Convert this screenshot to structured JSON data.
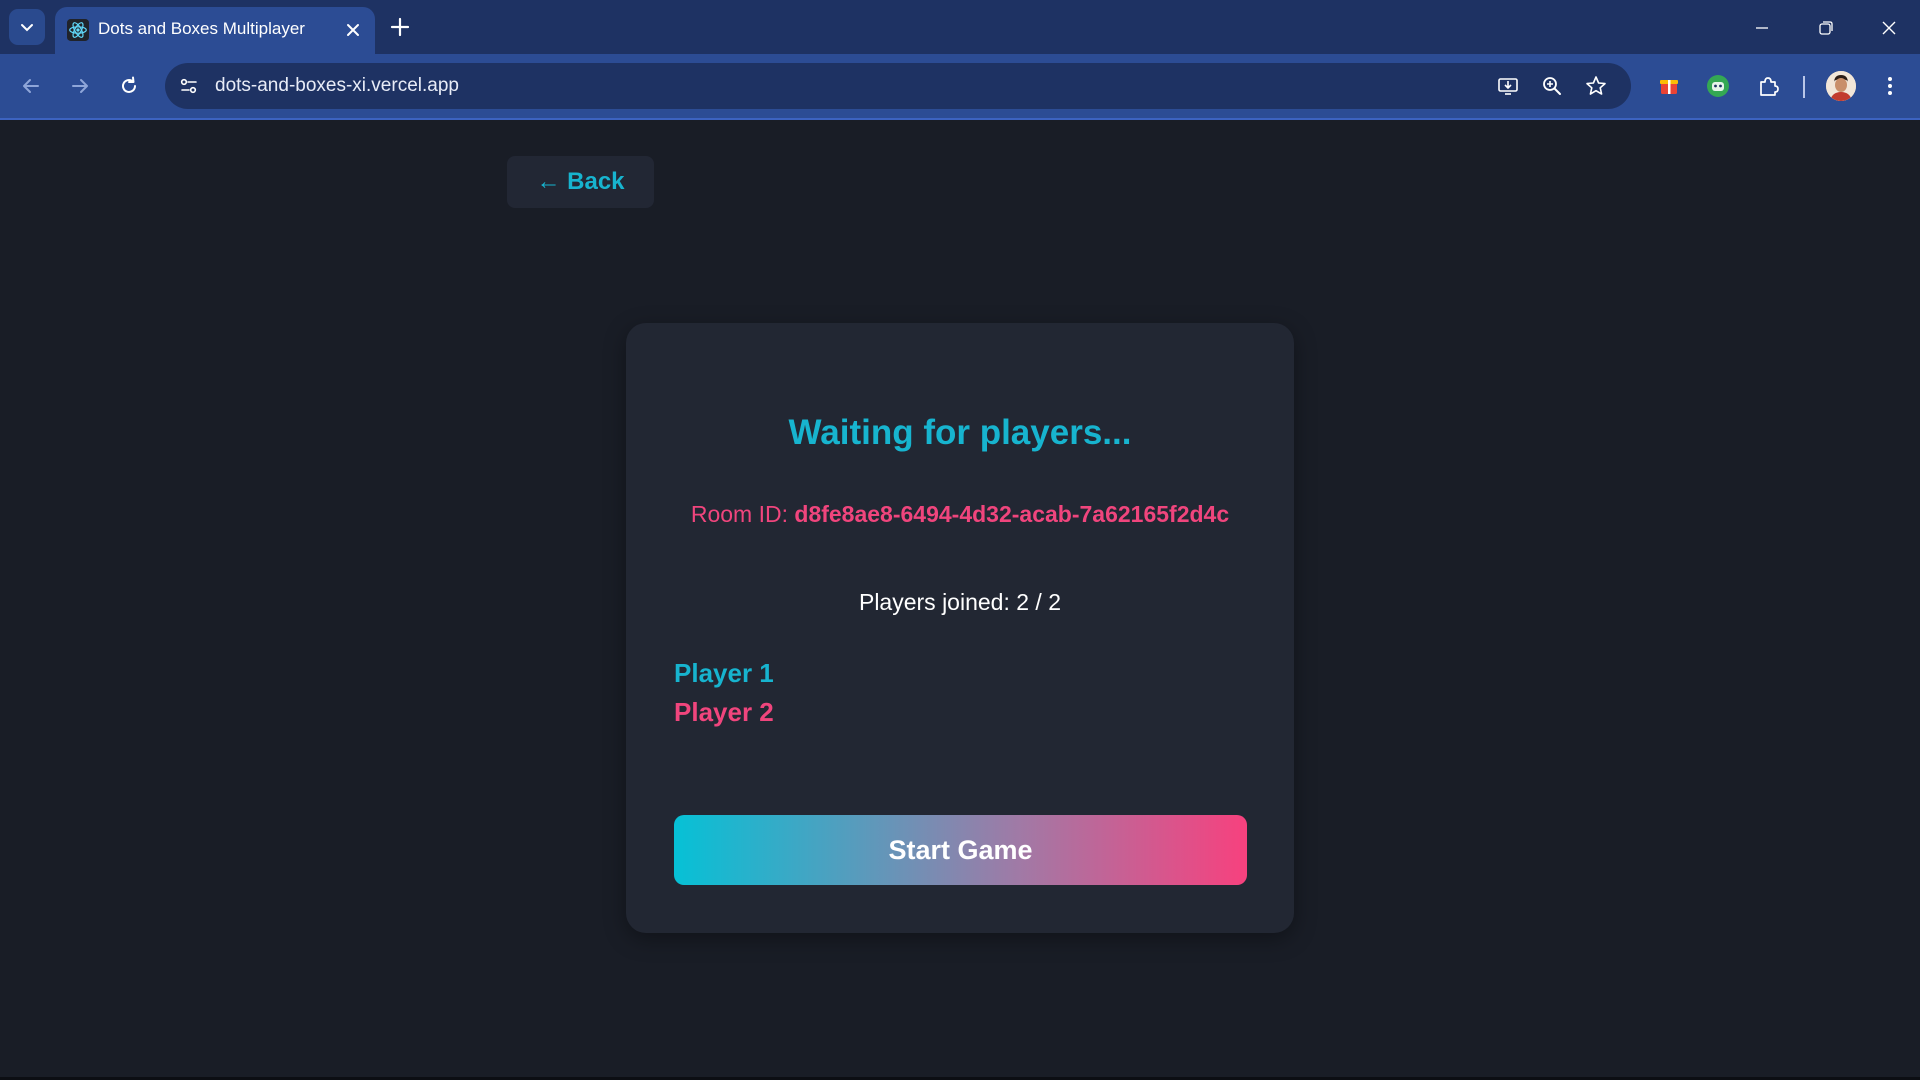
{
  "browser": {
    "tab": {
      "title": "Dots and Boxes Multiplayer",
      "favicon": "react-atom-icon"
    },
    "address_bar": {
      "url": "dots-and-boxes-xi.vercel.app"
    },
    "colors": {
      "tabbar": "#1e3263",
      "toolbar": "#2c4c94"
    }
  },
  "page": {
    "back_label": "← Back",
    "title": "Waiting for players...",
    "room": {
      "label": "Room ID: ",
      "id": "d8fe8ae8-6494-4d32-acab-7a62165f2d4c"
    },
    "players_joined": "Players joined: 2 / 2",
    "players": [
      {
        "name": "Player 1",
        "color": "#17b4cf"
      },
      {
        "name": "Player 2",
        "color": "#f0457d"
      }
    ],
    "start_label": "Start Game",
    "colors": {
      "accent_cyan": "#17b4cf",
      "accent_pink": "#f0457d",
      "background": "#191d26",
      "card": "#222733"
    }
  }
}
